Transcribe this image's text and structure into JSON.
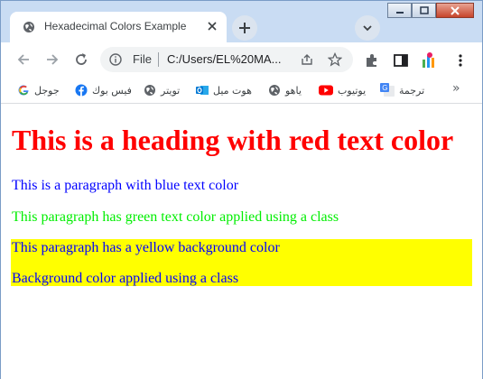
{
  "window": {
    "tab_title": "Hexadecimal Colors Example",
    "controls": [
      "minimize",
      "maximize",
      "close"
    ]
  },
  "toolbar": {
    "scheme": "File",
    "url": "C:/Users/EL%20MA...",
    "icons": [
      "back-icon",
      "forward-icon",
      "reload-icon",
      "info-icon",
      "share-icon",
      "star-icon",
      "extensions-icon",
      "side-panel-icon",
      "profile-icon",
      "menu-icon"
    ]
  },
  "bookmarks": [
    {
      "label": "جوجل",
      "icon": "google-icon",
      "color": "#4285f4"
    },
    {
      "label": "فيس بوك",
      "icon": "facebook-icon",
      "color": "#1877f2"
    },
    {
      "label": "تويتر",
      "icon": "globe-icon",
      "color": "#5f6368"
    },
    {
      "label": "هوت ميل",
      "icon": "outlook-icon",
      "color": "#0078d4"
    },
    {
      "label": "ياهو",
      "icon": "globe-icon",
      "color": "#5f6368"
    },
    {
      "label": "يوتيوب",
      "icon": "youtube-icon",
      "color": "#ff0000"
    },
    {
      "label": "ترجمة",
      "icon": "translate-icon",
      "color": "#4285f4"
    }
  ],
  "bookmarks_more": "»",
  "page": {
    "heading": "This is a heading with red text color",
    "heading_color": "#ff0000",
    "p_blue": "This is a paragraph with blue text color",
    "p_blue_color": "#0000ff",
    "p_green": "This paragraph has green text color applied using a class",
    "p_green_color": "#00ee00",
    "p_yellow": "This paragraph has a yellow background color",
    "p_yellow2": "Background color applied using a class",
    "yellow_bg": "#ffff00"
  }
}
